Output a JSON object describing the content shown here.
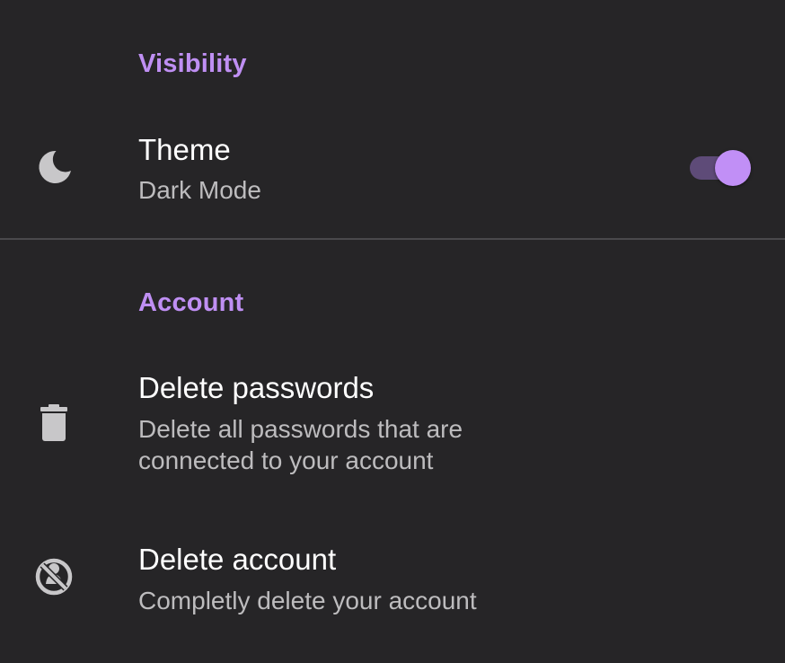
{
  "sections": {
    "visibility": {
      "header": "Visibility",
      "theme": {
        "title": "Theme",
        "subtitle": "Dark Mode",
        "icon": "moon-icon",
        "toggle_on": true
      }
    },
    "account": {
      "header": "Account",
      "delete_passwords": {
        "title": "Delete passwords",
        "subtitle": "Delete all passwords that are connected to your account",
        "icon": "trash-icon"
      },
      "delete_account": {
        "title": "Delete account",
        "subtitle": "Completly delete your account",
        "icon": "block-account-icon"
      }
    }
  },
  "colors": {
    "background": "#262527",
    "accent": "#bf8ff3",
    "title_text": "#ffffff",
    "subtitle_text": "#bdbcbe",
    "icon": "#c8c7c9"
  }
}
